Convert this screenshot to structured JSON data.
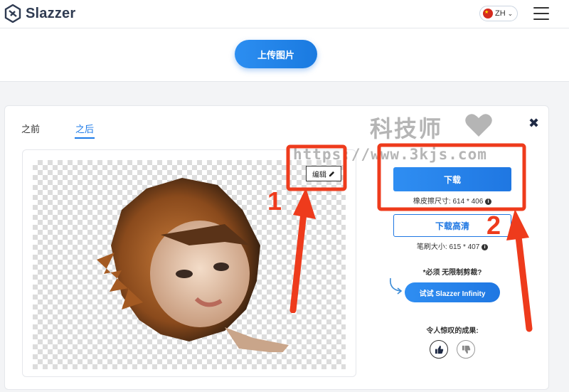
{
  "header": {
    "logo_text": "Slazzer",
    "language": "ZH",
    "lang_chevron": "⌄",
    "menu_icon": "hamburger-icon"
  },
  "upload": {
    "button_label": "上传图片"
  },
  "card": {
    "tabs": [
      {
        "label": "之前",
        "active": false
      },
      {
        "label": "之后",
        "active": true
      }
    ],
    "close_label": "✖",
    "preview": {
      "edit_label": "编辑"
    },
    "actions": {
      "download_label": "下载",
      "eraser_size_text": "橡皮擦尺寸: 614 * 406",
      "hd_download_label": "下载高清",
      "brush_size_text": "笔刷大小: 615 * 407",
      "must_text": "*必须 无限制剪裁?",
      "infinity_label": "试试 Slazzer Infinity",
      "amazing_text": "令人惊叹的成果:"
    }
  },
  "annotations": {
    "watermark_title": "科技师",
    "watermark_url": "https://www.3kjs.com",
    "marker_1": "1",
    "marker_2": "2"
  },
  "colors": {
    "brand_blue": "#1f77e2",
    "annotation_red": "#ee3b1c"
  }
}
